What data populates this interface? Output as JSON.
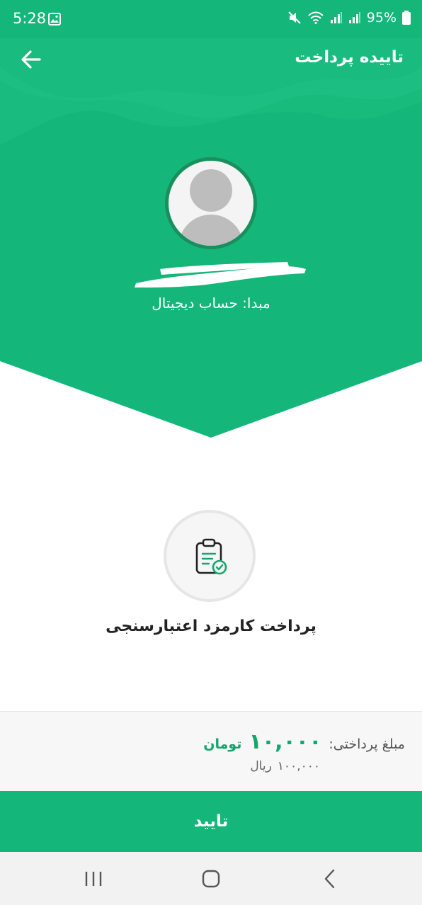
{
  "status_bar": {
    "time": "5:28",
    "battery": "95%"
  },
  "header": {
    "title": "تاییده پرداخت"
  },
  "account": {
    "source_label": "مبدا: حساب دیجیتال"
  },
  "service": {
    "title": "پرداخت کارمزد اعتبارسنجی"
  },
  "payment": {
    "amount_label": "مبلغ پرداختی:",
    "amount_value": "۱۰,۰۰۰",
    "amount_unit": "تومان",
    "rial_value": "۱۰۰,۰۰۰",
    "rial_unit": "ریال"
  },
  "actions": {
    "confirm_label": "تایید"
  },
  "colors": {
    "brand": "#14b779",
    "accent_text": "#13a66d"
  },
  "icons": [
    "back-arrow-icon",
    "image-icon",
    "mute-icon",
    "wifi-icon",
    "signal-icon",
    "battery-icon",
    "clipboard-check-icon",
    "recents-icon",
    "home-icon",
    "nav-back-icon"
  ]
}
